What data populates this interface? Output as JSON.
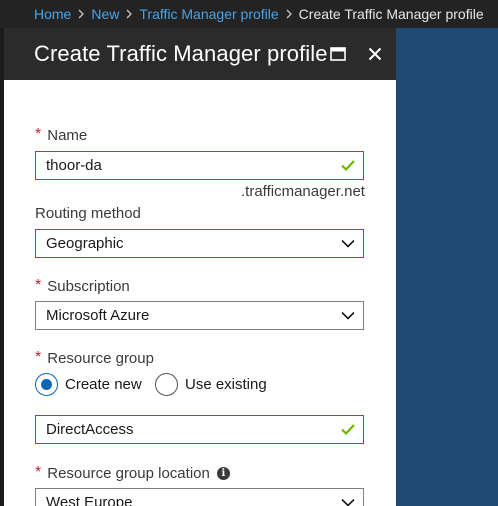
{
  "breadcrumb": {
    "items": [
      "Home",
      "New",
      "Traffic Manager profile"
    ],
    "current": "Create Traffic Manager profile"
  },
  "blade": {
    "title": "Create Traffic Manager profile",
    "maximize_icon": "maximize-icon",
    "close_icon": "close-icon"
  },
  "form": {
    "name": {
      "label": "Name",
      "required": "*",
      "value": "thoor-da",
      "suffix": ".trafficmanager.net",
      "status_icon": "checkmark-icon"
    },
    "routing_method": {
      "label": "Routing method",
      "value": "Geographic",
      "icon": "chevron-down-icon"
    },
    "subscription": {
      "label": "Subscription",
      "required": "*",
      "value": "Microsoft Azure",
      "icon": "chevron-down-icon"
    },
    "resource_group": {
      "label": "Resource group",
      "required": "*",
      "options": [
        {
          "label": "Create new",
          "checked": true
        },
        {
          "label": "Use existing",
          "checked": false
        }
      ],
      "value": "DirectAccess",
      "status_icon": "checkmark-icon"
    },
    "resource_group_location": {
      "label": "Resource group location",
      "required": "*",
      "info_icon": "info-icon",
      "value": "West Europe",
      "icon": "chevron-down-icon"
    }
  },
  "colors": {
    "accent": "#0c67b7",
    "valid_border": "#8e33c4",
    "check": "#6bb700",
    "required": "#c4262e",
    "link": "#4aa3e6",
    "header_bg": "#2b2b2b",
    "backdrop": "#1e4a73"
  }
}
